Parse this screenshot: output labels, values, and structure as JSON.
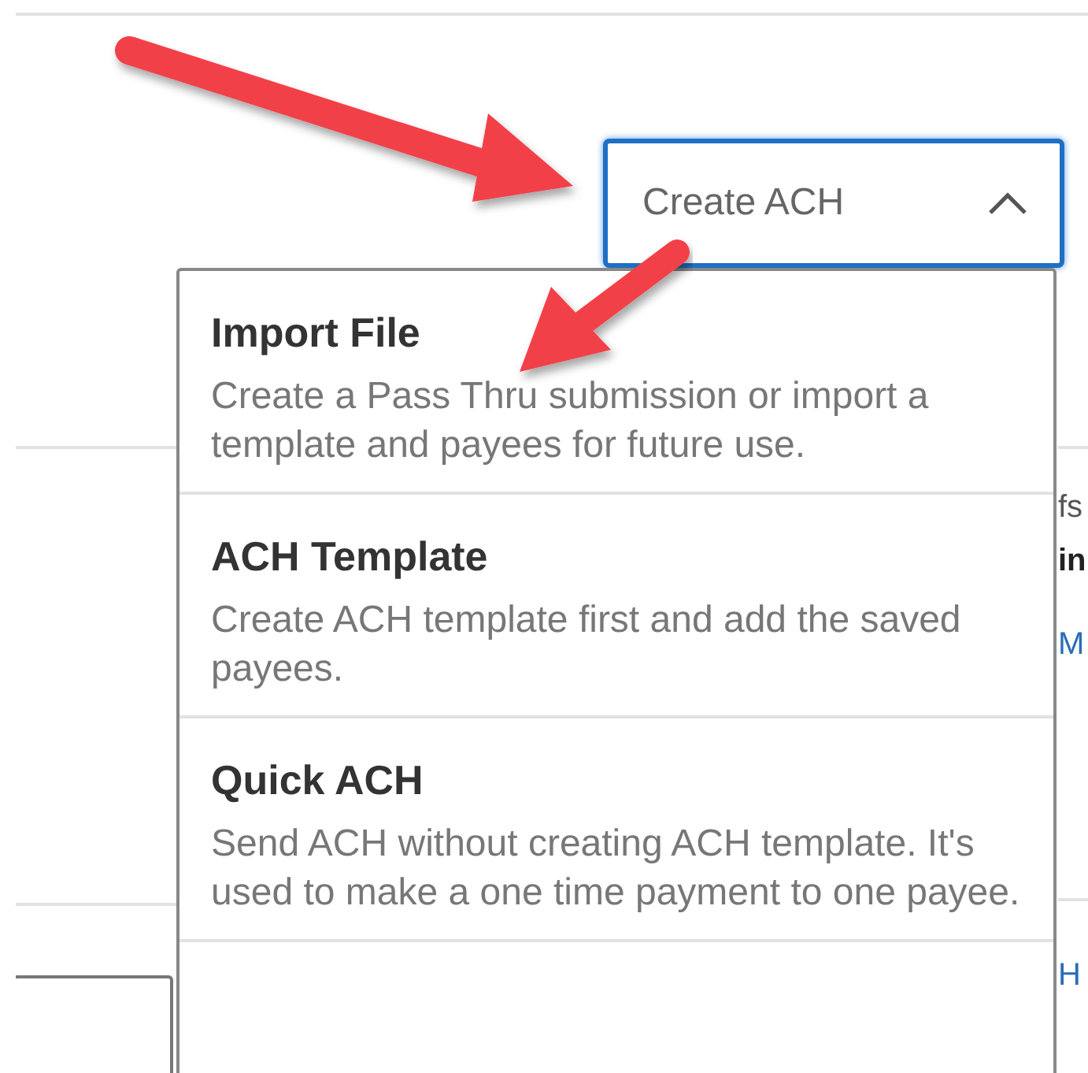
{
  "dropdown": {
    "label": "Create ACH",
    "expanded": true
  },
  "menu_items": [
    {
      "title": "Import File",
      "description": "Create a Pass Thru submission or import a template and payees for future use."
    },
    {
      "title": "ACH Template",
      "description": "Create ACH template first and add the saved payees."
    },
    {
      "title": "Quick ACH",
      "description": "Send ACH without creating ACH template. It's used to make a one time payment to one payee."
    }
  ],
  "background_fragments": [
    {
      "text": "fs",
      "kind": "plain"
    },
    {
      "text": "in",
      "kind": "bold"
    },
    {
      "text": "M",
      "kind": "link"
    },
    {
      "text": "H",
      "kind": "link"
    }
  ]
}
